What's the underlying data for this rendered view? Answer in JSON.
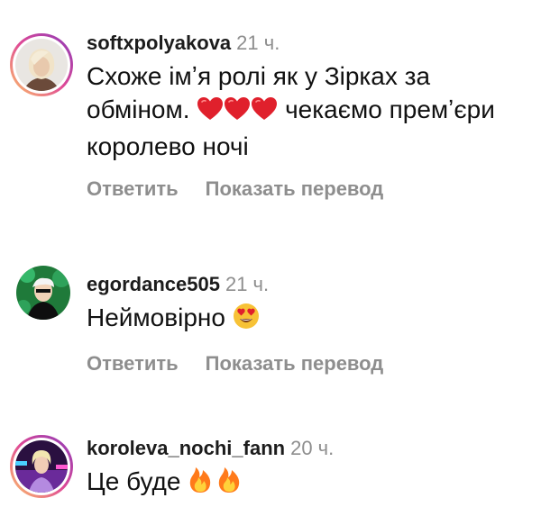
{
  "comments": [
    {
      "username": "softxpolyakova",
      "time": "21 ч.",
      "text_before": "Схоже імʼя ролі як у Зірках за обміном. ",
      "emoji_mid": [
        "heart-emoji",
        "heart-emoji",
        "heart-emoji"
      ],
      "text_after": " чекаємо премʼєри королево ночі",
      "reply_label": "Ответить",
      "translate_label": "Показать перевод"
    },
    {
      "username": "egordance505",
      "time": "21 ч.",
      "text_before": "Неймовірно ",
      "emoji_end": [
        "heart-eyes-emoji"
      ],
      "reply_label": "Ответить",
      "translate_label": "Показать перевод"
    },
    {
      "username": "koroleva_nochi_fann",
      "time": "20 ч.",
      "text_before": "Це буде ",
      "emoji_end": [
        "fire-emoji",
        "fire-emoji"
      ]
    }
  ],
  "colors": {
    "heart": "#e0202c",
    "story_ring_gradient": [
      "#fdc468",
      "#df4996",
      "#8a3ab9"
    ],
    "secondary_text": "#8e8e8e"
  }
}
